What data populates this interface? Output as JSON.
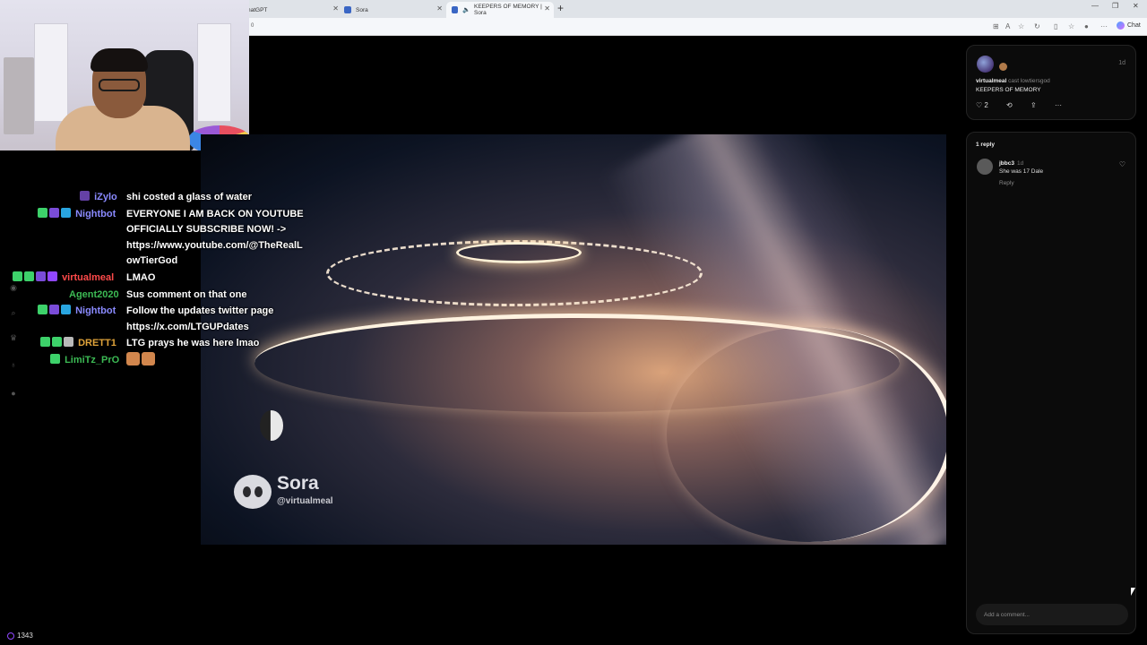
{
  "browser": {
    "tabs": [
      {
        "label": "hatGPT",
        "active": false
      },
      {
        "label": "Sora",
        "active": false
      },
      {
        "label": "KEEPERS OF MEMORY | Sora",
        "active": true
      }
    ],
    "new_tab": "+",
    "address": "0",
    "chat_button": "Chat"
  },
  "icons": {
    "tab_close": "close-icon",
    "speaker": "speaker-icon",
    "new_tab": "plus-icon",
    "minimize": "minimize-icon",
    "restore": "restore-icon",
    "close_window": "close-icon"
  },
  "chat": {
    "messages": [
      {
        "user": "iZylo",
        "user_color": "#8a8aff",
        "text_lines": [
          "shi costed a glass of water"
        ]
      },
      {
        "user": "Nightbot",
        "user_color": "#8a8aff",
        "text_lines": [
          "EVERYONE I AM BACK ON YOUTUBE",
          "OFFICIALLY SUBSCRIBE NOW! ->",
          "https://www.youtube.com/@TheRealL",
          "owTierGod"
        ]
      },
      {
        "user": "virtualmeal",
        "user_color": "#ff4a4a",
        "text_lines": [
          "LMAO"
        ]
      },
      {
        "user": "Agent2020",
        "user_color": "#3cba54",
        "text_lines": [
          "Sus comment on that one"
        ]
      },
      {
        "user": "Nightbot",
        "user_color": "#8a8aff",
        "text_lines": [
          "Follow the updates twitter page",
          "https://x.com/LTGUPdates"
        ]
      },
      {
        "user": "DRETT1",
        "user_color": "#e0a33a",
        "text_lines": [
          "LTG prays he was here lmao"
        ]
      },
      {
        "user": "LimiTz_PrO",
        "user_color": "#3cba54",
        "text_lines": [
          ""
        ]
      }
    ],
    "viewer_count": "1343"
  },
  "video": {
    "watermark_title": "Sora",
    "watermark_handle": "@virtualmeal"
  },
  "post": {
    "time": "1d",
    "author": "virtualmeal",
    "author_suffix": "cast lowtiersgod",
    "title": "KEEPERS OF MEMORY",
    "like_count": "2",
    "more": "···"
  },
  "replies": {
    "count_label": "1 reply",
    "items": [
      {
        "name": "jbbc3",
        "time": "1d",
        "text": "She was 17 Dale",
        "reply_label": "Reply"
      }
    ],
    "comment_placeholder": "Add a comment..."
  }
}
